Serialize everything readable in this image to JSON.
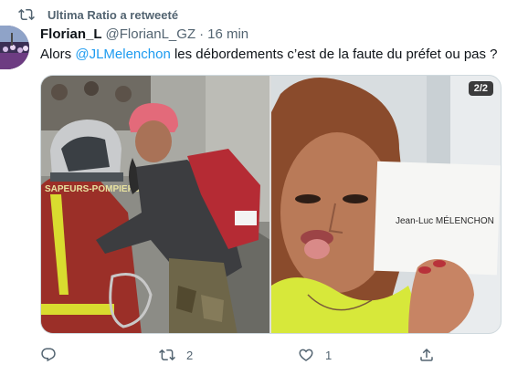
{
  "retweet_banner": {
    "text": "Ultima Ratio a retweeté",
    "icon": "retweet-icon"
  },
  "author": {
    "display_name": "Florian_L",
    "handle": "@FlorianL_GZ",
    "separator": "·",
    "time": "16 min"
  },
  "tweet": {
    "text_before": "Alors ",
    "mention": "@JLMelenchon",
    "text_after": " les débordements c’est de la faute du préfet ou pas ?"
  },
  "media": {
    "counter": "2/2",
    "left_image": {
      "helmet_text": "SAPEURS-POMPIERS PARIS"
    },
    "right_image": {
      "card_text": "Jean-Luc MÉLENCHON"
    }
  },
  "actions": {
    "reply": {
      "icon": "reply-icon",
      "count": ""
    },
    "retweet": {
      "icon": "retweet-icon",
      "count": "2"
    },
    "like": {
      "icon": "heart-icon",
      "count": "1"
    },
    "share": {
      "icon": "share-icon",
      "count": ""
    }
  },
  "colors": {
    "accent": "#1d9bf0",
    "secondary_text": "#536471",
    "primary_text": "#0f1419",
    "border": "#cfd9de"
  }
}
